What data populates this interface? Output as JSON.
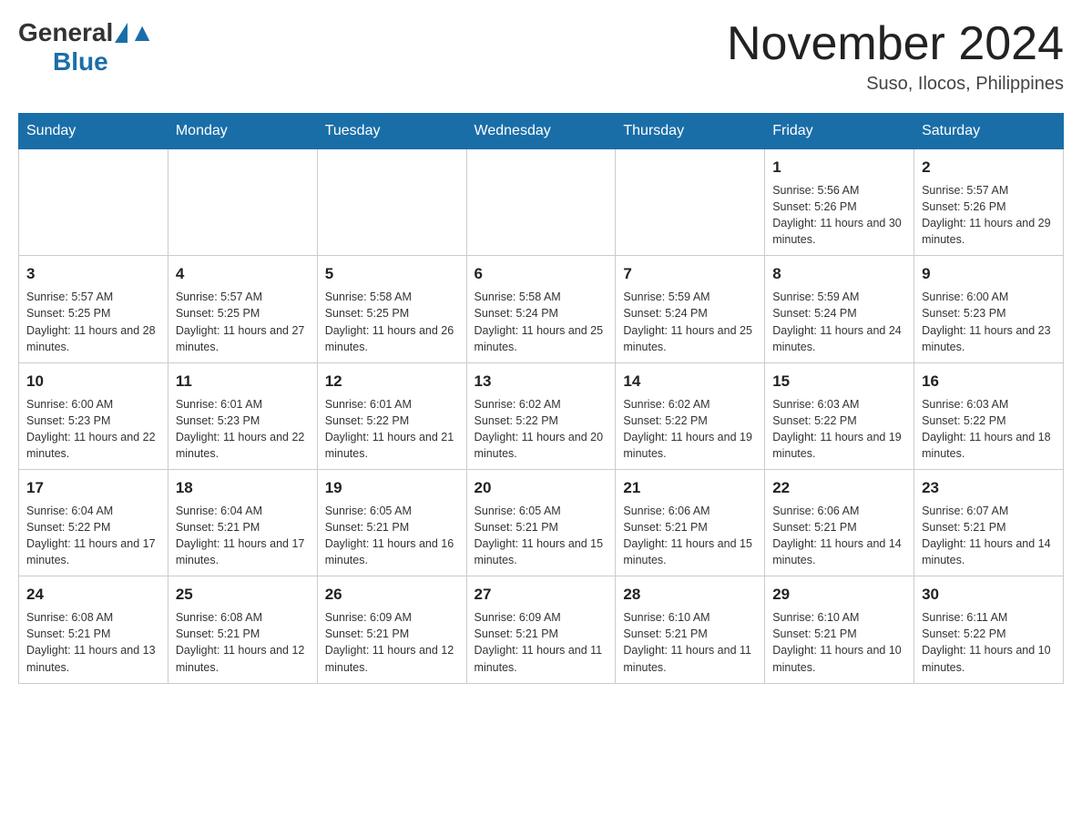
{
  "header": {
    "logo_general": "General",
    "logo_blue": "Blue",
    "month_title": "November 2024",
    "location": "Suso, Ilocos, Philippines"
  },
  "weekdays": [
    "Sunday",
    "Monday",
    "Tuesday",
    "Wednesday",
    "Thursday",
    "Friday",
    "Saturday"
  ],
  "weeks": [
    [
      {
        "day": "",
        "info": ""
      },
      {
        "day": "",
        "info": ""
      },
      {
        "day": "",
        "info": ""
      },
      {
        "day": "",
        "info": ""
      },
      {
        "day": "",
        "info": ""
      },
      {
        "day": "1",
        "info": "Sunrise: 5:56 AM\nSunset: 5:26 PM\nDaylight: 11 hours and 30 minutes."
      },
      {
        "day": "2",
        "info": "Sunrise: 5:57 AM\nSunset: 5:26 PM\nDaylight: 11 hours and 29 minutes."
      }
    ],
    [
      {
        "day": "3",
        "info": "Sunrise: 5:57 AM\nSunset: 5:25 PM\nDaylight: 11 hours and 28 minutes."
      },
      {
        "day": "4",
        "info": "Sunrise: 5:57 AM\nSunset: 5:25 PM\nDaylight: 11 hours and 27 minutes."
      },
      {
        "day": "5",
        "info": "Sunrise: 5:58 AM\nSunset: 5:25 PM\nDaylight: 11 hours and 26 minutes."
      },
      {
        "day": "6",
        "info": "Sunrise: 5:58 AM\nSunset: 5:24 PM\nDaylight: 11 hours and 25 minutes."
      },
      {
        "day": "7",
        "info": "Sunrise: 5:59 AM\nSunset: 5:24 PM\nDaylight: 11 hours and 25 minutes."
      },
      {
        "day": "8",
        "info": "Sunrise: 5:59 AM\nSunset: 5:24 PM\nDaylight: 11 hours and 24 minutes."
      },
      {
        "day": "9",
        "info": "Sunrise: 6:00 AM\nSunset: 5:23 PM\nDaylight: 11 hours and 23 minutes."
      }
    ],
    [
      {
        "day": "10",
        "info": "Sunrise: 6:00 AM\nSunset: 5:23 PM\nDaylight: 11 hours and 22 minutes."
      },
      {
        "day": "11",
        "info": "Sunrise: 6:01 AM\nSunset: 5:23 PM\nDaylight: 11 hours and 22 minutes."
      },
      {
        "day": "12",
        "info": "Sunrise: 6:01 AM\nSunset: 5:22 PM\nDaylight: 11 hours and 21 minutes."
      },
      {
        "day": "13",
        "info": "Sunrise: 6:02 AM\nSunset: 5:22 PM\nDaylight: 11 hours and 20 minutes."
      },
      {
        "day": "14",
        "info": "Sunrise: 6:02 AM\nSunset: 5:22 PM\nDaylight: 11 hours and 19 minutes."
      },
      {
        "day": "15",
        "info": "Sunrise: 6:03 AM\nSunset: 5:22 PM\nDaylight: 11 hours and 19 minutes."
      },
      {
        "day": "16",
        "info": "Sunrise: 6:03 AM\nSunset: 5:22 PM\nDaylight: 11 hours and 18 minutes."
      }
    ],
    [
      {
        "day": "17",
        "info": "Sunrise: 6:04 AM\nSunset: 5:22 PM\nDaylight: 11 hours and 17 minutes."
      },
      {
        "day": "18",
        "info": "Sunrise: 6:04 AM\nSunset: 5:21 PM\nDaylight: 11 hours and 17 minutes."
      },
      {
        "day": "19",
        "info": "Sunrise: 6:05 AM\nSunset: 5:21 PM\nDaylight: 11 hours and 16 minutes."
      },
      {
        "day": "20",
        "info": "Sunrise: 6:05 AM\nSunset: 5:21 PM\nDaylight: 11 hours and 15 minutes."
      },
      {
        "day": "21",
        "info": "Sunrise: 6:06 AM\nSunset: 5:21 PM\nDaylight: 11 hours and 15 minutes."
      },
      {
        "day": "22",
        "info": "Sunrise: 6:06 AM\nSunset: 5:21 PM\nDaylight: 11 hours and 14 minutes."
      },
      {
        "day": "23",
        "info": "Sunrise: 6:07 AM\nSunset: 5:21 PM\nDaylight: 11 hours and 14 minutes."
      }
    ],
    [
      {
        "day": "24",
        "info": "Sunrise: 6:08 AM\nSunset: 5:21 PM\nDaylight: 11 hours and 13 minutes."
      },
      {
        "day": "25",
        "info": "Sunrise: 6:08 AM\nSunset: 5:21 PM\nDaylight: 11 hours and 12 minutes."
      },
      {
        "day": "26",
        "info": "Sunrise: 6:09 AM\nSunset: 5:21 PM\nDaylight: 11 hours and 12 minutes."
      },
      {
        "day": "27",
        "info": "Sunrise: 6:09 AM\nSunset: 5:21 PM\nDaylight: 11 hours and 11 minutes."
      },
      {
        "day": "28",
        "info": "Sunrise: 6:10 AM\nSunset: 5:21 PM\nDaylight: 11 hours and 11 minutes."
      },
      {
        "day": "29",
        "info": "Sunrise: 6:10 AM\nSunset: 5:21 PM\nDaylight: 11 hours and 10 minutes."
      },
      {
        "day": "30",
        "info": "Sunrise: 6:11 AM\nSunset: 5:22 PM\nDaylight: 11 hours and 10 minutes."
      }
    ]
  ]
}
